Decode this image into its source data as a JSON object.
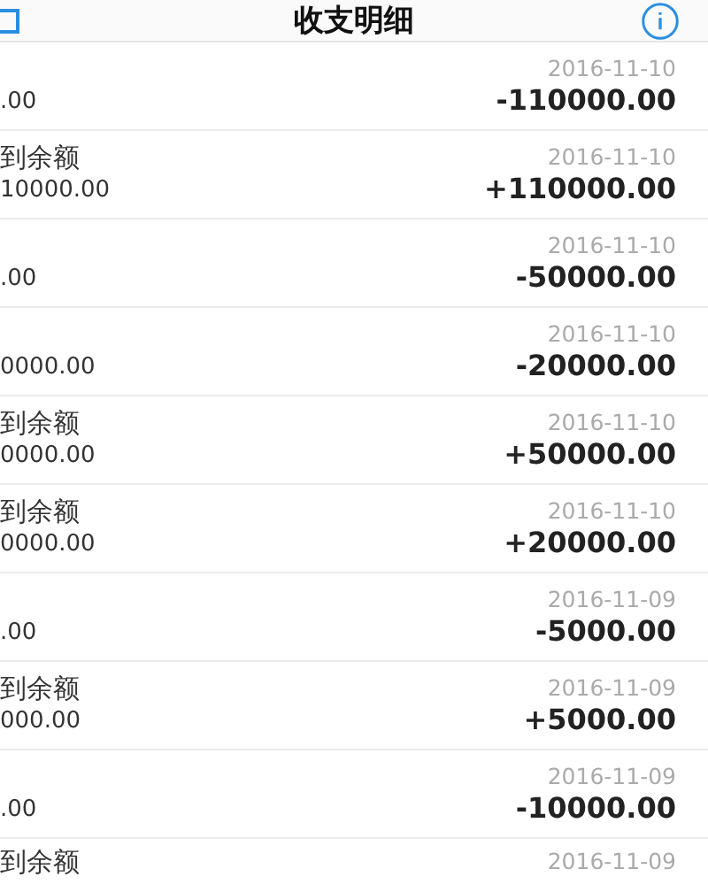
{
  "header": {
    "title": "收支明细"
  },
  "rows": [
    {
      "title": "",
      "sub": ".00",
      "date": "2016-11-10",
      "amount": "-110000.00"
    },
    {
      "title": "到余额",
      "sub": "10000.00",
      "date": "2016-11-10",
      "amount": "+110000.00"
    },
    {
      "title": "",
      "sub": ".00",
      "date": "2016-11-10",
      "amount": "-50000.00"
    },
    {
      "title": "",
      "sub": "0000.00",
      "date": "2016-11-10",
      "amount": "-20000.00"
    },
    {
      "title": "到余额",
      "sub": "0000.00",
      "date": "2016-11-10",
      "amount": "+50000.00"
    },
    {
      "title": "到余额",
      "sub": "0000.00",
      "date": "2016-11-10",
      "amount": "+20000.00"
    },
    {
      "title": "",
      "sub": ".00",
      "date": "2016-11-09",
      "amount": "-5000.00"
    },
    {
      "title": "到余额",
      "sub": "000.00",
      "date": "2016-11-09",
      "amount": "+5000.00"
    },
    {
      "title": "",
      "sub": ".00",
      "date": "2016-11-09",
      "amount": "-10000.00"
    },
    {
      "title": "到余额",
      "sub": "",
      "date": "2016-11-09",
      "amount": ""
    }
  ]
}
